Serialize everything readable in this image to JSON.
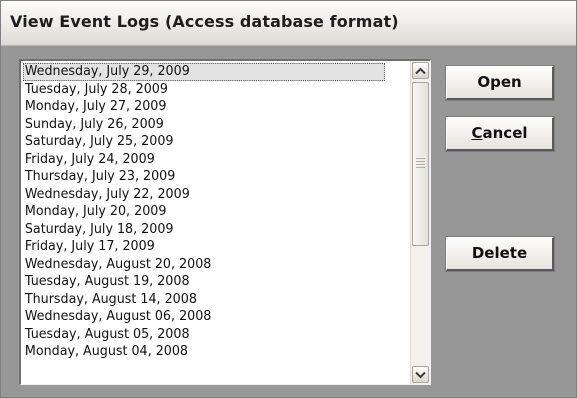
{
  "window": {
    "title": "View Event Logs (Access database format)"
  },
  "event_list": {
    "selected_index": 0,
    "items": [
      "Wednesday, July 29, 2009",
      "Tuesday, July 28, 2009",
      "Monday, July 27, 2009",
      "Sunday, July 26, 2009",
      "Saturday, July 25, 2009",
      "Friday, July 24, 2009",
      "Thursday, July 23, 2009",
      "Wednesday, July 22, 2009",
      "Monday, July 20, 2009",
      "Saturday, July 18, 2009",
      "Friday, July 17, 2009",
      "Wednesday, August 20, 2008",
      "Tuesday, August 19, 2008",
      "Thursday, August 14, 2008",
      "Wednesday, August 06, 2008",
      "Tuesday, August 05, 2008",
      "Monday, August 04, 2008"
    ]
  },
  "buttons": {
    "open_label": "Open",
    "cancel_label_mnemonic": "C",
    "cancel_label_rest": "ancel",
    "delete_label": "Delete"
  },
  "icons": {
    "scroll_up": "chevron-up-icon",
    "scroll_down": "chevron-down-icon",
    "scroll_grip": "grip-icon"
  }
}
